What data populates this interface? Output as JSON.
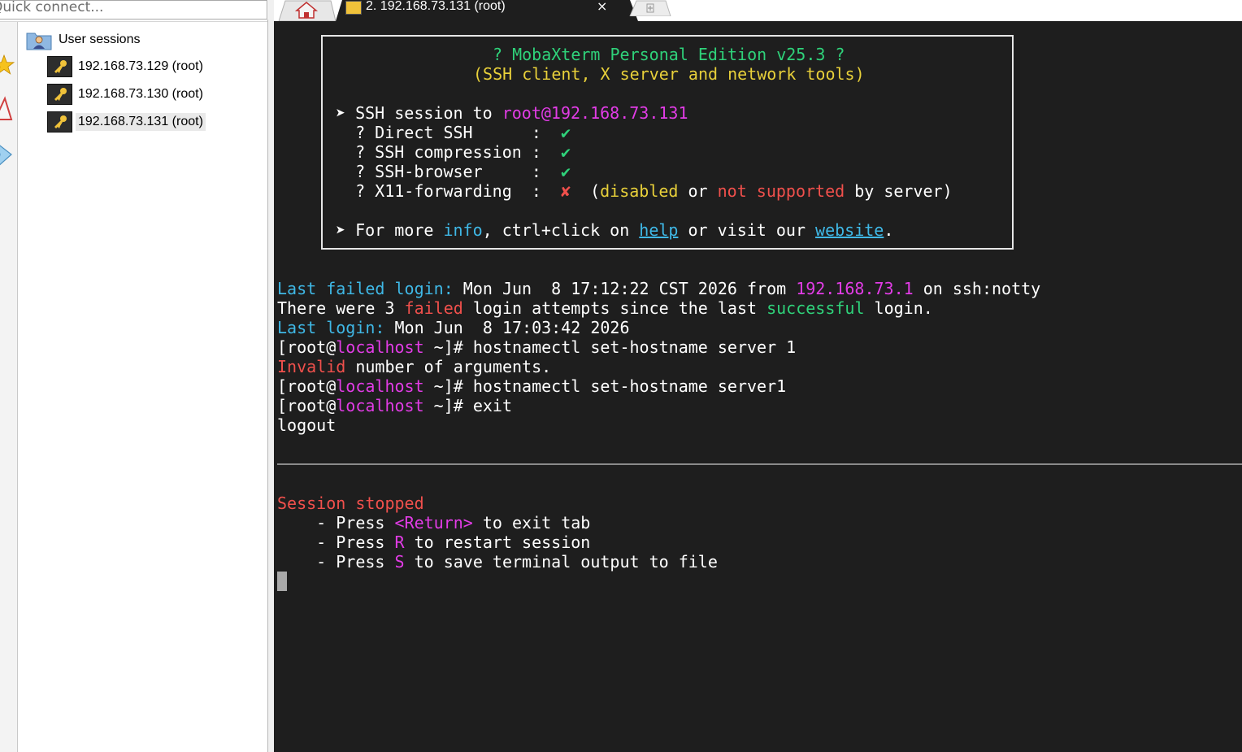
{
  "quick_connect": {
    "placeholder": "Quick connect..."
  },
  "sidebar": {
    "folder": {
      "label": "User sessions",
      "icon": "user-folder-icon"
    },
    "sessions": [
      {
        "label": "192.168.73.129 (root)",
        "icon": "key-icon"
      },
      {
        "label": "192.168.73.130 (root)",
        "icon": "key-icon"
      },
      {
        "label": "192.168.73.131 (root)",
        "icon": "key-icon"
      }
    ]
  },
  "tabs": {
    "home_icon": "home-icon",
    "active": {
      "title": "2. 192.168.73.131 (root)",
      "close": "×"
    },
    "new_tab_icon": "plus-icon"
  },
  "terminal": {
    "banner": {
      "title": "? MobaXterm Personal Edition v25.3 ?",
      "subtitle": "(SSH client, X server and network tools)",
      "session_prefix": "➤ SSH session to ",
      "session_target": "root@192.168.73.131",
      "features": [
        {
          "label": "  ? Direct SSH      :  ",
          "mark": "✔"
        },
        {
          "label": "  ? SSH compression :  ",
          "mark": "✔"
        },
        {
          "label": "  ? SSH-browser     :  ",
          "mark": "✔"
        },
        {
          "label": "  ? X11-forwarding  :  ",
          "mark": "✘"
        }
      ],
      "x11_note": {
        "open": "  (",
        "disabled": "disabled",
        "or": " or ",
        "not_supported": "not supported",
        "tail": " by server)"
      },
      "info_line": {
        "prefix": "➤ For more ",
        "info": "info",
        "mid": ", ctrl+click on ",
        "help": "help",
        "mid2": " or visit our ",
        "website": "website",
        "end": "."
      }
    },
    "last_failed": {
      "label": "Last failed login:",
      "date": " Mon Jun  8 17:12:22 CST 2026 from ",
      "ip": "192.168.73.1",
      "tail": " on ssh:notty"
    },
    "attempts": {
      "pre": "There were 3 ",
      "failed": "failed",
      "mid": " login attempts since the last ",
      "successful": "successful",
      "end": " login."
    },
    "last_login": {
      "label": "Last login:",
      "date": " Mon Jun  8 17:03:42 2026"
    },
    "prompt": {
      "open": "[root@",
      "host": "localhost",
      "close": " ~]# "
    },
    "commands": [
      "hostnamectl set-hostname server 1",
      "hostnamectl set-hostname server1",
      "exit"
    ],
    "error": {
      "word": "Invalid",
      "rest": " number of arguments."
    },
    "logout": "logout",
    "session_stopped": "Session stopped",
    "help_lines": [
      {
        "pre": "    - Press ",
        "key": "<Return>",
        "post": " to exit tab"
      },
      {
        "pre": "    - Press ",
        "key": "R",
        "post": " to restart session"
      },
      {
        "pre": "    - Press ",
        "key": "S",
        "post": " to save terminal output to file"
      }
    ]
  },
  "colors": {
    "terminal_bg": "#1e1e1e",
    "green": "#2fd27a",
    "cyan": "#3fb8e6",
    "magenta": "#e23ce6",
    "red": "#f0504c",
    "yellow": "#e8d03a"
  }
}
